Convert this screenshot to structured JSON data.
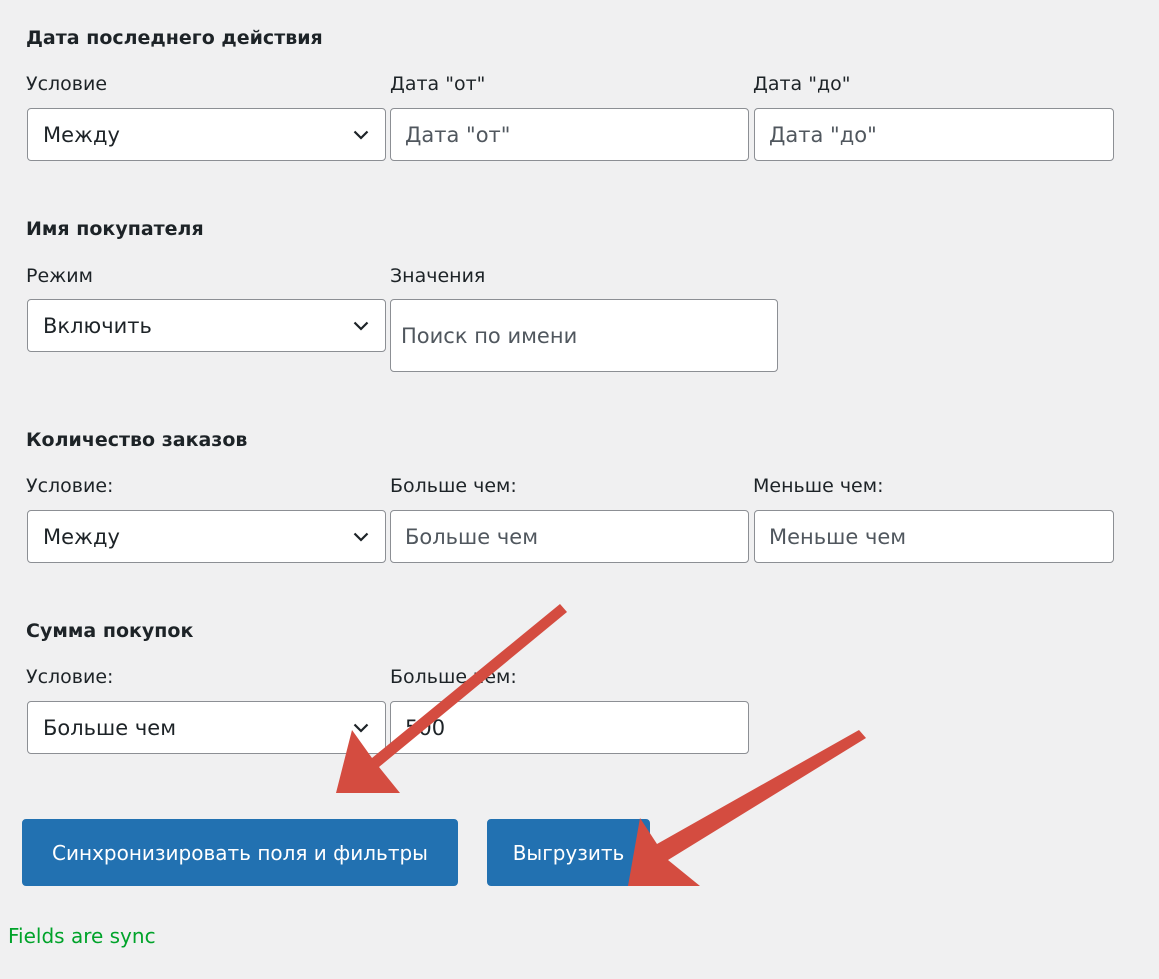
{
  "sections": {
    "last_action": {
      "title": "Дата последнего действия",
      "condition_label": "Условие",
      "condition_value": "Между",
      "from_label": "Дата \"от\"",
      "from_placeholder": "Дата \"от\"",
      "to_label": "Дата \"до\"",
      "to_placeholder": "Дата \"до\""
    },
    "customer_name": {
      "title": "Имя покупателя",
      "mode_label": "Режим",
      "mode_value": "Включить",
      "values_label": "Значения",
      "values_placeholder": "Поиск по имени"
    },
    "orders_count": {
      "title": "Количество заказов",
      "condition_label": "Условие:",
      "condition_value": "Между",
      "more_label": "Больше чем:",
      "more_placeholder": "Больше чем",
      "less_label": "Меньше чем:",
      "less_placeholder": "Меньше чем"
    },
    "purchase_sum": {
      "title": "Сумма покупок",
      "condition_label": "Условие:",
      "condition_value": "Больше чем",
      "more_label": "Больше чем:",
      "more_value": "500"
    }
  },
  "buttons": {
    "sync_label": "Синхронизировать поля и фильтры",
    "export_label": "Выгрузить"
  },
  "status": {
    "message": "Fields are sync"
  },
  "colors": {
    "primary_button": "#2271b1",
    "status_text": "#00a32a",
    "annotation_arrow": "#d9534f",
    "background": "#f0f0f1"
  },
  "icons": {
    "select_chevron": "chevron-down-icon",
    "annotation": "arrow-annotation"
  }
}
